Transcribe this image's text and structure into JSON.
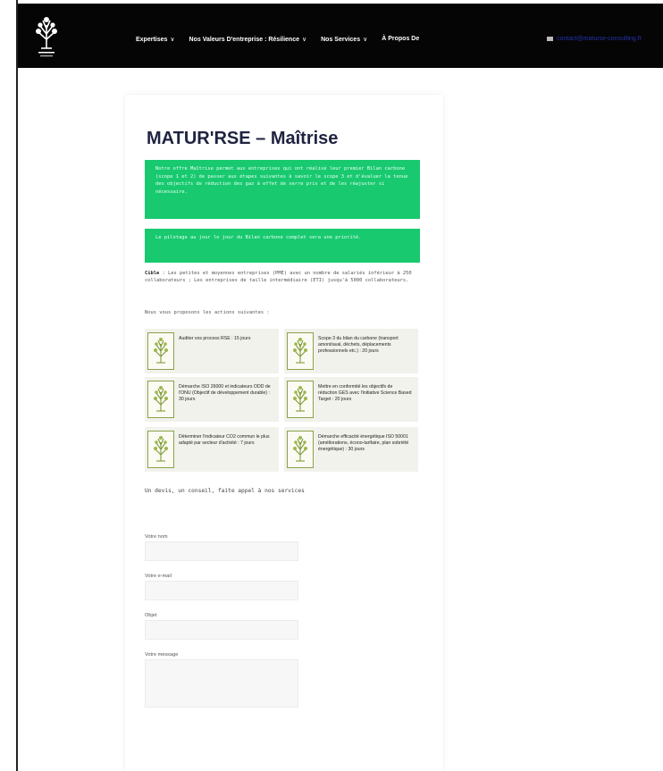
{
  "header": {
    "nav": [
      {
        "label": "Expertises",
        "has_dropdown": true
      },
      {
        "label": "Nos Valeurs D'entreprise : Résilience",
        "has_dropdown": true
      },
      {
        "label": "Nos Services",
        "has_dropdown": true
      },
      {
        "label": "À Propos De",
        "has_dropdown": false
      }
    ],
    "contact_email": "contact@maturse-consulting.fr",
    "icons": {
      "logo": "tree-logo-icon",
      "mail": "mail-icon",
      "dropdown": "chevron-down-icon"
    }
  },
  "page": {
    "title": "MATUR'RSE – Maîtrise",
    "intro_box": "Notre offre Maîtrise permet aux entreprises qui ont réalisé leur premier Bilan carbone (scope 1 et 2) de passer aux étapes suivantes à savoir le scope 3 et d'évaluer la tenue des objectifs de réduction des gaz à effet de serre pris et de les réajuster si nécessaire.",
    "pilot_box": "Le pilotage au jour le jour du Bilan carbone complet sera une priorité.",
    "cible_label": "Cible",
    "cible_text": " : Les petites et moyennes entreprises (PME) avec un nombre de salariés inférieur à 250 collaborateurs ; Les entreprises de taille intermédiaire (ETI) jusqu'à 5000 collaborateurs.",
    "actions_intro": "Nous vous proposons les actions suivantes :",
    "actions": [
      {
        "text": "Auditer vos process RSE : 15 jours"
      },
      {
        "text": "Scope 3 du bilan du carbone (transport amont/aval, déchets, déplacements professionnels etc.) : 20 jours"
      },
      {
        "text": "Démarche ISO 26000 et indicateurs ODD de l'ONU (Objectif de développement durable) : 30 jours"
      },
      {
        "text": "Mettre en conformité les objectifs de réduction GES avec l'initiative Science Based Target : 20 jours"
      },
      {
        "text": "Déterminer l'indicateur CO2 commun le plus adapté par secteur d'activité : 7 jours"
      },
      {
        "text": "Démarche efficacité énergétique ISO 50001 (améliorations, écono-tarifaire, plan sobriété énergétique) : 30 jours"
      }
    ],
    "devis_text": "Un devis, un conseil, faite appel à nos services",
    "form": {
      "name_label": "Votre nom",
      "email_label": "Votre e-mail",
      "subject_label": "Objet",
      "message_label": "Votre message"
    }
  },
  "colors": {
    "topbar": "#050505",
    "accent_green": "#18c96f",
    "title": "#1f2340",
    "action_bg": "#f2f2ec",
    "thumb_border": "#8aa24a"
  }
}
